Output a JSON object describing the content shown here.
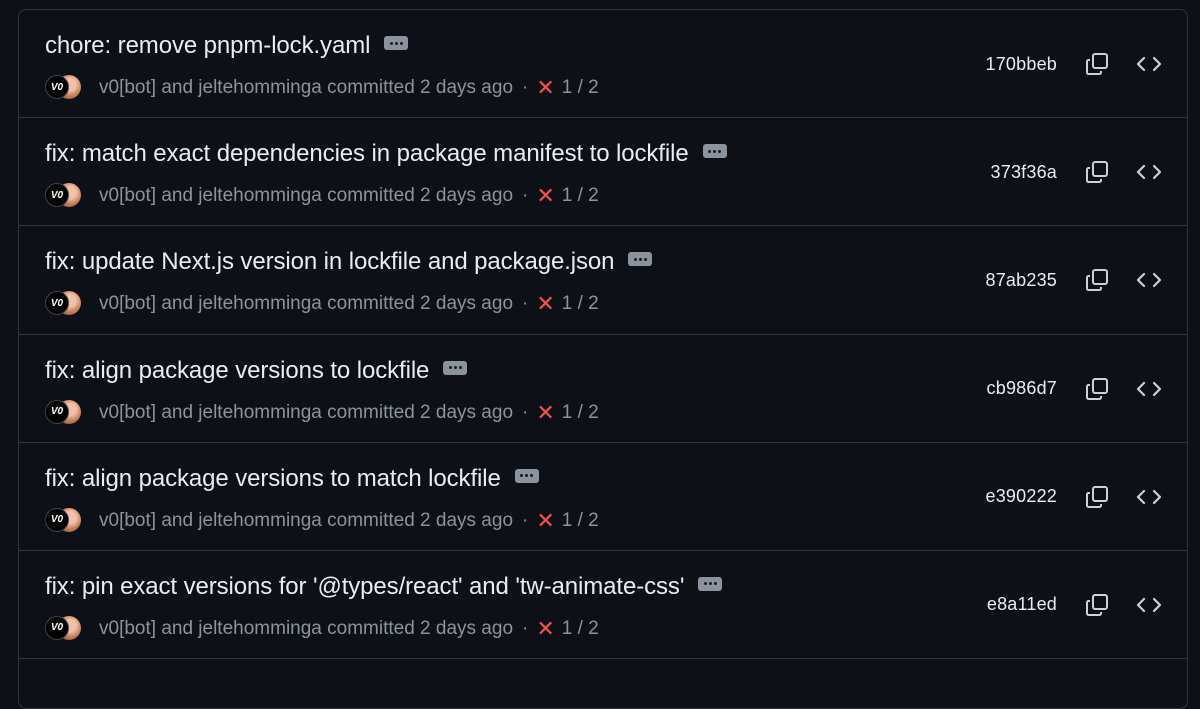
{
  "commits": [
    {
      "title": "chore: remove pnpm-lock.yaml",
      "authors": "v0[bot] and jeltehomminga committed 2 days ago",
      "status": "1 / 2",
      "sha": "170bbeb"
    },
    {
      "title": "fix: match exact dependencies in package manifest to lockfile",
      "authors": "v0[bot] and jeltehomminga committed 2 days ago",
      "status": "1 / 2",
      "sha": "373f36a"
    },
    {
      "title": "fix: update Next.js version in lockfile and package.json",
      "authors": "v0[bot] and jeltehomminga committed 2 days ago",
      "status": "1 / 2",
      "sha": "87ab235"
    },
    {
      "title": "fix: align package versions to lockfile",
      "authors": "v0[bot] and jeltehomminga committed 2 days ago",
      "status": "1 / 2",
      "sha": "cb986d7"
    },
    {
      "title": "fix: align package versions to match lockfile",
      "authors": "v0[bot] and jeltehomminga committed 2 days ago",
      "status": "1 / 2",
      "sha": "e390222"
    },
    {
      "title": "fix: pin exact versions for '@types/react' and 'tw-animate-css'",
      "authors": "v0[bot] and jeltehomminga committed 2 days ago",
      "status": "1 / 2",
      "sha": "e8a11ed"
    }
  ],
  "labels": {
    "bot_avatar": "V0",
    "separator": "·",
    "fail_mark": "✕"
  },
  "icons": {
    "copy": "copy-icon",
    "browse": "code-icon",
    "more": "kebab-horizontal-icon",
    "status": "x-icon"
  },
  "colors": {
    "background": "#0d1117",
    "border": "#30363d",
    "text": "#e6edf3",
    "muted": "#8b949e",
    "fail": "#f85149"
  }
}
